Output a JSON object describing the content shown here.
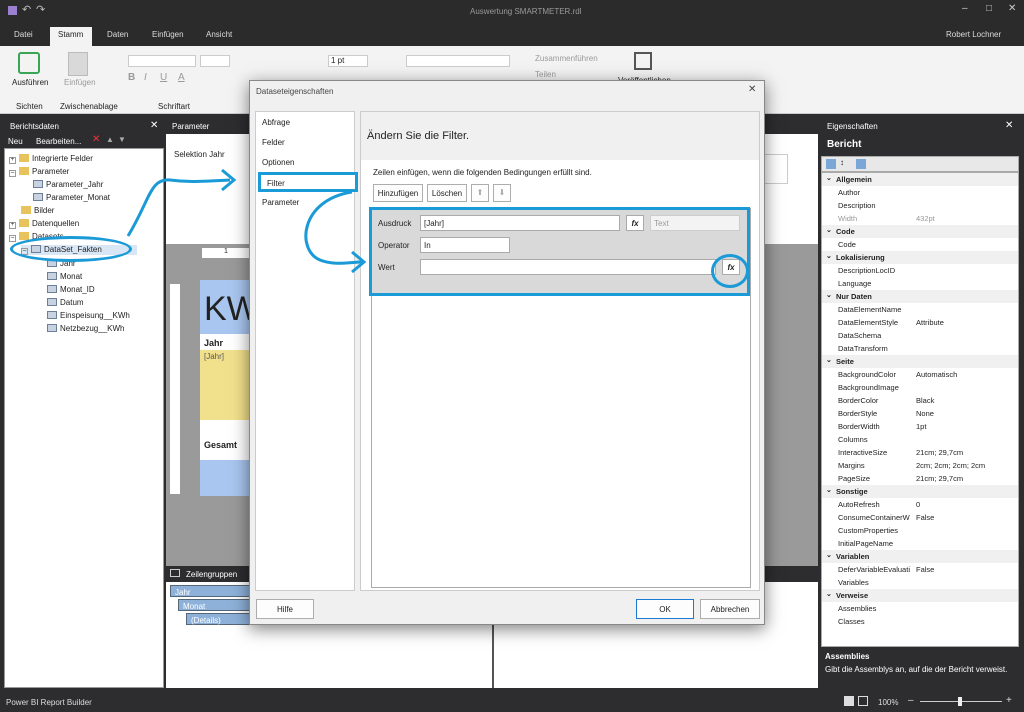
{
  "window": {
    "title": "Auswertung SMARTMETER.rdl",
    "user": "Robert Lochner"
  },
  "menu": {
    "tabs": [
      "Datei",
      "Stamm",
      "Daten",
      "Einfügen",
      "Ansicht"
    ],
    "active": "Stamm"
  },
  "ribbon": {
    "run_label": "Ausführen",
    "paste_label": "Einfügen",
    "font_size": "1 pt",
    "merge_label": "Zusammenführen",
    "split_label": "Teilen",
    "publish_label": "Veröffentlichen",
    "groups": [
      "Sichten",
      "Zwischenablage",
      "Schriftart"
    ]
  },
  "left": {
    "title": "Berichtsdaten",
    "new_label": "Neu",
    "edit_label": "Bearbeiten...",
    "tree": [
      "Integrierte Felder",
      "Parameter",
      "Parameter_Jahr",
      "Parameter_Monat",
      "Bilder",
      "Datenquellen",
      "Datasets",
      "DataSet_Fakten",
      "Jahr",
      "Monat",
      "Monat_ID",
      "Datum",
      "Einspeisung__KWh",
      "Netzbezug__KWh"
    ]
  },
  "canvas": {
    "param_title": "Parameter",
    "param_select": "Selektion Jahr",
    "kw": "KW",
    "jahr": "Jahr",
    "jahr_expr": "[Jahr]",
    "gesamt": "Gesamt",
    "ruler": "1"
  },
  "groups": {
    "title": "Zeilengruppen",
    "items": [
      "Jahr",
      "Monat",
      "(Details)"
    ]
  },
  "dialog": {
    "title": "Dataseteigenschaften",
    "nav": [
      "Abfrage",
      "Felder",
      "Optionen",
      "Filter",
      "Parameter"
    ],
    "active_nav": "Filter",
    "heading": "Ändern Sie die Filter.",
    "instruction": "Zeilen einfügen, wenn die folgenden Bedingungen erfüllt sind.",
    "add": "Hinzufügen",
    "delete": "Löschen",
    "expr_label": "Ausdruck",
    "expr_value": "[Jahr]",
    "type_value": "Text",
    "op_label": "Operator",
    "op_value": "In",
    "val_label": "Wert",
    "help": "Hilfe",
    "ok": "OK",
    "cancel": "Abbrechen",
    "fx": "fx"
  },
  "props": {
    "title": "Eigenschaften",
    "object": "Bericht",
    "rows": [
      [
        "s",
        "Allgemein",
        ""
      ],
      [
        "p",
        "Author",
        ""
      ],
      [
        "p",
        "Description",
        ""
      ],
      [
        "d",
        "Width",
        "432pt"
      ],
      [
        "s",
        "Code",
        ""
      ],
      [
        "p",
        "Code",
        ""
      ],
      [
        "s",
        "Lokalisierung",
        ""
      ],
      [
        "p",
        "DescriptionLocID",
        ""
      ],
      [
        "p",
        "Language",
        ""
      ],
      [
        "s",
        "Nur Daten",
        ""
      ],
      [
        "p",
        "DataElementName",
        ""
      ],
      [
        "p",
        "DataElementStyle",
        "Attribute"
      ],
      [
        "p",
        "DataSchema",
        ""
      ],
      [
        "p",
        "DataTransform",
        ""
      ],
      [
        "s",
        "Seite",
        ""
      ],
      [
        "p",
        "BackgroundColor",
        "Automatisch"
      ],
      [
        "p",
        "BackgroundImage",
        ""
      ],
      [
        "p",
        "BorderColor",
        "Black"
      ],
      [
        "p",
        "BorderStyle",
        "None"
      ],
      [
        "p",
        "BorderWidth",
        "1pt"
      ],
      [
        "p",
        "Columns",
        ""
      ],
      [
        "p",
        "InteractiveSize",
        "21cm; 29,7cm"
      ],
      [
        "p",
        "Margins",
        "2cm; 2cm; 2cm; 2cm"
      ],
      [
        "p",
        "PageSize",
        "21cm; 29,7cm"
      ],
      [
        "s",
        "Sonstige",
        ""
      ],
      [
        "p",
        "AutoRefresh",
        "0"
      ],
      [
        "p",
        "ConsumeContainerW",
        "False"
      ],
      [
        "p",
        "CustomProperties",
        ""
      ],
      [
        "p",
        "InitialPageName",
        ""
      ],
      [
        "s",
        "Variablen",
        ""
      ],
      [
        "p",
        "DeferVariableEvaluati",
        "False"
      ],
      [
        "p",
        "Variables",
        ""
      ],
      [
        "s",
        "Verweise",
        ""
      ],
      [
        "p",
        "Assemblies",
        ""
      ],
      [
        "p",
        "Classes",
        ""
      ]
    ],
    "desc_title": "Assemblies",
    "desc_text": "Gibt die Assemblys an, auf die der Bericht verweist."
  },
  "status": {
    "app": "Power BI Report Builder",
    "zoom": "100%"
  },
  "colors": {
    "accent": "#1a9ad6",
    "ribbon_active": "#ffffff"
  }
}
